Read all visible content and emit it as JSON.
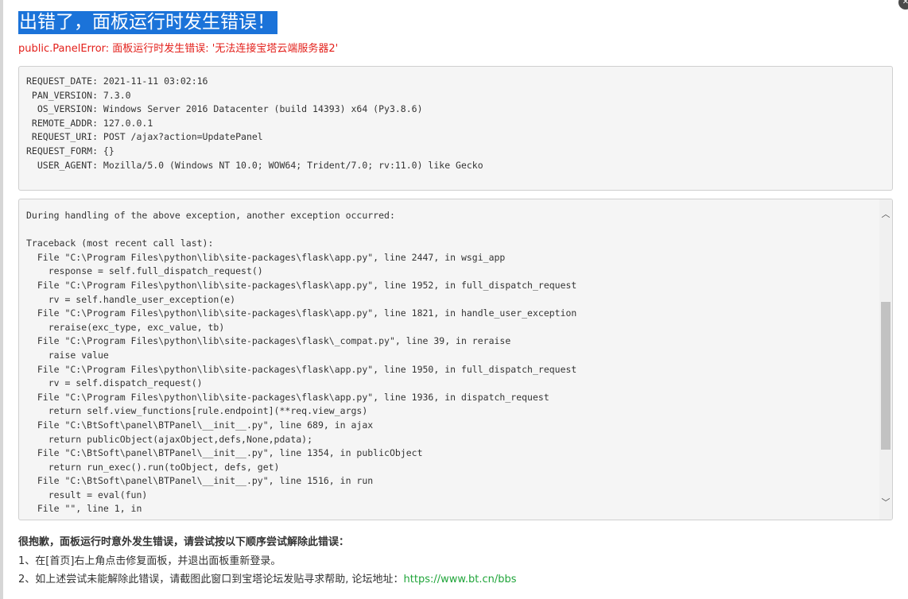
{
  "page": {
    "title": "出错了，面板运行时发生错误！",
    "error_message": "public.PanelError: 面板运行时发生错误: '无法连接宝塔云端服务器2'"
  },
  "request_info": {
    "text": "REQUEST_DATE: 2021-11-11 03:02:16\n PAN_VERSION: 7.3.0\n  OS_VERSION: Windows Server 2016 Datacenter (build 14393) x64 (Py3.8.6)\n REMOTE_ADDR: 127.0.0.1\n REQUEST_URI: POST /ajax?action=UpdatePanel\nREQUEST_FORM: {}\n  USER_AGENT: Mozilla/5.0 (Windows NT 10.0; WOW64; Trident/7.0; rv:11.0) like Gecko"
  },
  "traceback": {
    "text": "During handling of the above exception, another exception occurred:\n\nTraceback (most recent call last):\n  File \"C:\\Program Files\\python\\lib\\site-packages\\flask\\app.py\", line 2447, in wsgi_app\n    response = self.full_dispatch_request()\n  File \"C:\\Program Files\\python\\lib\\site-packages\\flask\\app.py\", line 1952, in full_dispatch_request\n    rv = self.handle_user_exception(e)\n  File \"C:\\Program Files\\python\\lib\\site-packages\\flask\\app.py\", line 1821, in handle_user_exception\n    reraise(exc_type, exc_value, tb)\n  File \"C:\\Program Files\\python\\lib\\site-packages\\flask\\_compat.py\", line 39, in reraise\n    raise value\n  File \"C:\\Program Files\\python\\lib\\site-packages\\flask\\app.py\", line 1950, in full_dispatch_request\n    rv = self.dispatch_request()\n  File \"C:\\Program Files\\python\\lib\\site-packages\\flask\\app.py\", line 1936, in dispatch_request\n    return self.view_functions[rule.endpoint](**req.view_args)\n  File \"C:\\BtSoft\\panel\\BTPanel\\__init__.py\", line 689, in ajax\n    return publicObject(ajaxObject,defs,None,pdata);\n  File \"C:\\BtSoft\\panel\\BTPanel\\__init__.py\", line 1354, in publicObject\n    return run_exec().run(toObject, defs, get)\n  File \"C:\\BtSoft\\panel\\BTPanel\\__init__.py\", line 1516, in run\n    result = eval(fun)\n  File \"\", line 1, in"
  },
  "help": {
    "heading": "很抱歉，面板运行时意外发生错误，请尝试按以下顺序尝试解除此错误：",
    "step1": "1、在[首页]右上角点击修复面板，并退出面板重新登录。",
    "step2_prefix": "2、如上述尝试未能解除此错误，请截图此窗口到宝塔论坛发贴寻求帮助, 论坛地址：",
    "forum_link": "https://www.bt.cn/bbs"
  },
  "colors": {
    "title_bg": "#1b73d9",
    "error_text": "#e3201b",
    "link": "#20a53a"
  },
  "icons": {
    "close": "close-icon",
    "scroll_up": "chevron-up-icon",
    "scroll_down": "chevron-down-icon"
  }
}
